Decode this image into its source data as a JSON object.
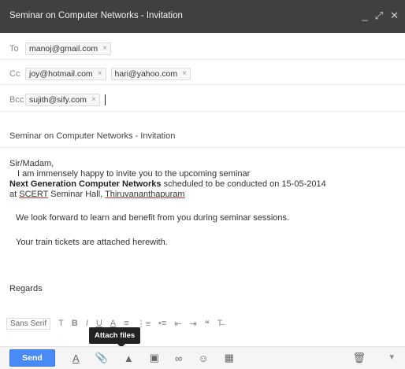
{
  "window": {
    "title": "Seminar on Computer Networks - Invitation",
    "minimize_icon": "minimize-icon",
    "expand_icon": "expand-icon",
    "close_icon": "close-icon"
  },
  "recipients": {
    "to_label": "To",
    "to": [
      "manoj@gmail.com"
    ],
    "cc_label": "Cc",
    "cc": [
      "joy@hotmail.com",
      "hari@yahoo.com"
    ],
    "bcc_label": "Bcc",
    "bcc": [
      "sujith@sify.com"
    ],
    "remove_glyph": "×"
  },
  "subject": "Seminar on Computer Networks - Invitation",
  "body": {
    "greeting": "Sir/Madam,",
    "line1": "I am immensely happy to invite you to the upcoming seminar",
    "event_name": "Next Generation Computer Networks",
    "line2_rest": " scheduled to be conducted on 15-05-2014",
    "line3_prefix": "at ",
    "venue_org": "SCERT",
    "venue_mid": " Seminar Hall, ",
    "venue_city": "Thiruvananthapuram",
    "line4": "We look forward to learn and benefit from you during seminar sessions.",
    "line5": "Your train tickets are attached herewith.",
    "closing": "Regards"
  },
  "formatting": {
    "font_label": "Sans Serif",
    "tools": [
      "font-size-icon",
      "bold-icon",
      "italic-icon",
      "underline-icon",
      "text-color-icon",
      "align-icon",
      "numbered-list-icon",
      "bulleted-list-icon",
      "indent-less-icon",
      "indent-more-icon",
      "quote-icon",
      "remove-formatting-icon"
    ]
  },
  "tooltip": "Attach files",
  "footer": {
    "send_label": "Send",
    "icons": [
      "formatting-icon",
      "attach-icon",
      "drive-icon",
      "photo-icon",
      "link-icon",
      "emoji-icon",
      "calendar-icon"
    ],
    "trash_icon": "trash-icon",
    "more_icon": "more-options-icon"
  },
  "colors": {
    "titlebar": "#404040",
    "send": "#4a8af4",
    "tooltip": "#222222"
  }
}
